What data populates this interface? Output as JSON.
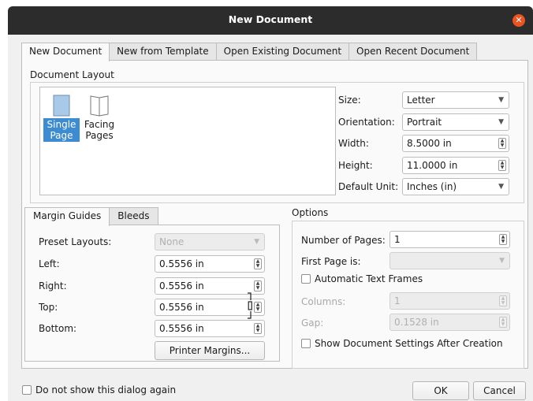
{
  "window": {
    "title": "New Document"
  },
  "tabs": [
    {
      "label": "New Document",
      "active": true
    },
    {
      "label": "New from Template"
    },
    {
      "label": "Open Existing Document"
    },
    {
      "label": "Open Recent Document"
    }
  ],
  "document_layout": {
    "heading": "Document Layout",
    "items": [
      {
        "label_line1": "Single",
        "label_line2": "Page",
        "selected": true,
        "icon": "single-page-icon"
      },
      {
        "label_line1": "Facing",
        "label_line2": "Pages",
        "selected": false,
        "icon": "facing-pages-icon"
      }
    ]
  },
  "page_settings": {
    "size": {
      "label": "Size:",
      "value": "Letter"
    },
    "orientation": {
      "label": "Orientation:",
      "value": "Portrait"
    },
    "width": {
      "label": "Width:",
      "value": "8.5000 in"
    },
    "height": {
      "label": "Height:",
      "value": "11.0000 in"
    },
    "default_unit": {
      "label": "Default Unit:",
      "value": "Inches (in)"
    }
  },
  "margin_tabs": [
    {
      "label": "Margin Guides",
      "active": true
    },
    {
      "label": "Bleeds"
    }
  ],
  "margins": {
    "preset": {
      "label": "Preset Layouts:",
      "value": "None"
    },
    "left": {
      "label": "Left:",
      "value": "0.5556 in"
    },
    "right": {
      "label": "Right:",
      "value": "0.5556 in"
    },
    "top": {
      "label": "Top:",
      "value": "0.5556 in"
    },
    "bottom": {
      "label": "Bottom:",
      "value": "0.5556 in"
    },
    "printer_margins_button": "Printer Margins..."
  },
  "options": {
    "heading": "Options",
    "pages": {
      "label": "Number of Pages:",
      "value": "1"
    },
    "first_page": {
      "label": "First Page is:",
      "value": ""
    },
    "auto_text_frames": {
      "label": "Automatic Text Frames",
      "checked": false
    },
    "columns": {
      "label": "Columns:",
      "value": "1"
    },
    "gap": {
      "label": "Gap:",
      "value": "0.1528 in"
    },
    "show_settings": {
      "label": "Show Document Settings After Creation",
      "checked": false
    }
  },
  "footer": {
    "dont_show": {
      "label": "Do not show this dialog again",
      "checked": false
    },
    "ok_label": "OK",
    "cancel_label": "Cancel"
  },
  "colors": {
    "accent": "#3d8bd0",
    "close": "#e95420",
    "titlebar": "#2c2c2c"
  }
}
